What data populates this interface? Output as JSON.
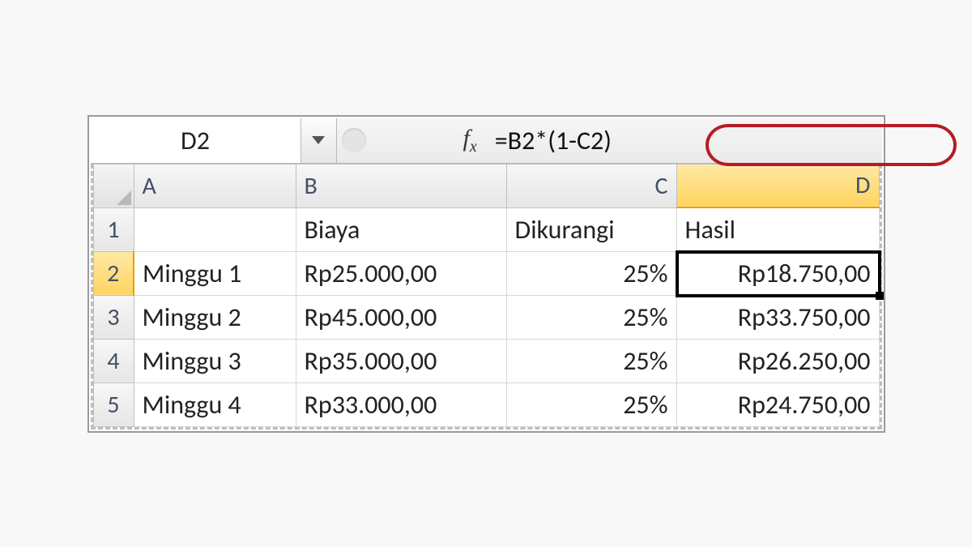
{
  "name_box": "D2",
  "formula": "=B2*(1-C2)",
  "columns": [
    "A",
    "B",
    "C",
    "D"
  ],
  "active_column": "D",
  "active_row": "2",
  "rows": [
    "1",
    "2",
    "3",
    "4",
    "5"
  ],
  "headers": {
    "A": "",
    "B": "Biaya",
    "C": "Dikurangi",
    "D": "Hasil"
  },
  "data": [
    {
      "A": "Minggu 1",
      "B": "Rp25.000,00",
      "C": "25%",
      "D": "Rp18.750,00"
    },
    {
      "A": "Minggu 2",
      "B": "Rp45.000,00",
      "C": "25%",
      "D": "Rp33.750,00"
    },
    {
      "A": "Minggu 3",
      "B": "Rp35.000,00",
      "C": "25%",
      "D": "Rp26.250,00"
    },
    {
      "A": "Minggu 4",
      "B": "Rp33.000,00",
      "C": "25%",
      "D": "Rp24.750,00"
    }
  ],
  "selected_cell": {
    "row": 0,
    "col": "D"
  }
}
